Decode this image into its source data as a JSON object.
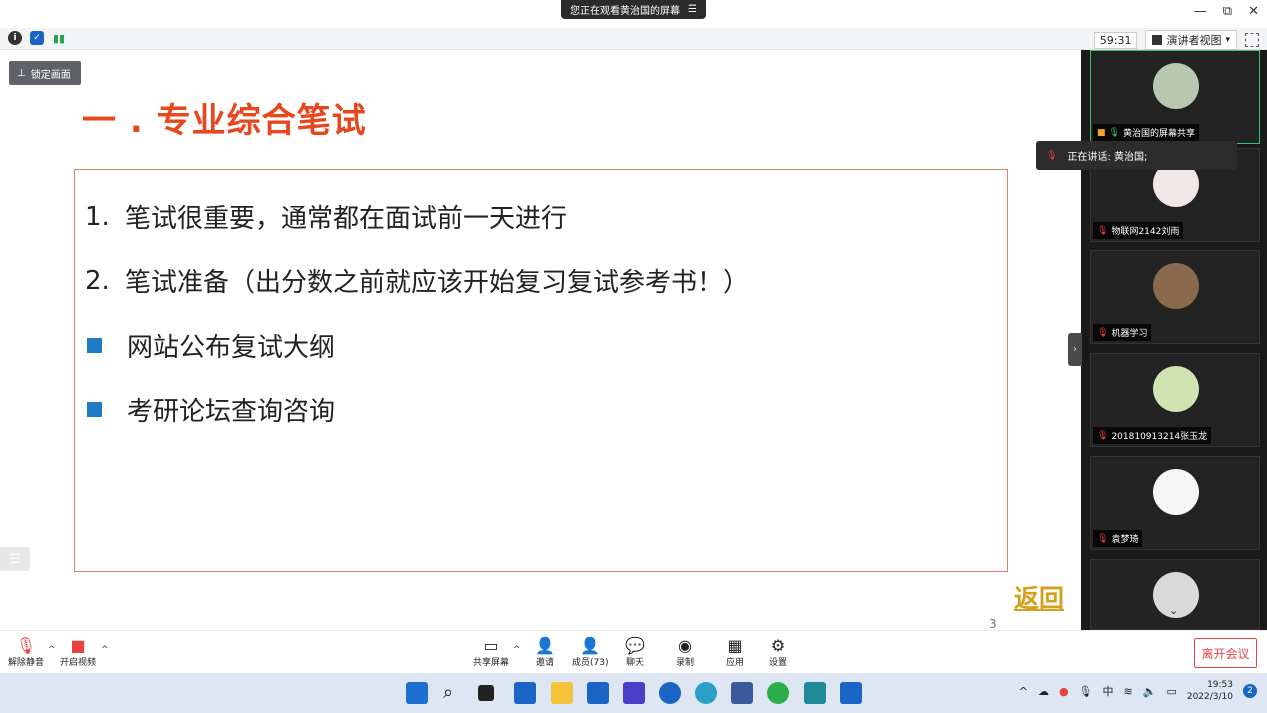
{
  "banner": {
    "text": "您正在观看黄治国的屏幕",
    "icon": "menu-icon"
  },
  "window": {
    "minimize": "—",
    "restore": "⧉",
    "close": "✕"
  },
  "toolbar": {
    "timer": "59:31",
    "presenter_view": "演讲者视图",
    "presenter_caret": "▾"
  },
  "slide": {
    "lock_label": "锁定画面",
    "title": "一 . 专业综合笔试",
    "lines": [
      {
        "num": "1.",
        "text": "笔试很重要，通常都在面试前一天进行"
      },
      {
        "num": "2.",
        "text": "笔试准备（出分数之前就应该开始复习复试参考书！）"
      },
      {
        "bullet": "square",
        "text": "网站公布复试大纲"
      },
      {
        "bullet": "square",
        "text": "考研论坛查询咨询"
      }
    ],
    "back_label": "返回",
    "page_number": "3"
  },
  "speaking_tooltip": {
    "text": "正在讲话: 黄治国;"
  },
  "participants": [
    {
      "label": "黄治国的屏幕共享",
      "avatar_color": "#b9c8b0"
    },
    {
      "label": "物联网2142刘雨",
      "avatar_color": "#f3e6e6"
    },
    {
      "label": "机器学习",
      "avatar_color": "#8a6a4e"
    },
    {
      "label": "201810913214张玉龙",
      "avatar_color": "#cfe4b0"
    },
    {
      "label": "袁梦琦",
      "avatar_color": "#f7f7f7"
    },
    {
      "label": "",
      "avatar_color": "#d9d9d9"
    }
  ],
  "controls": {
    "unmute": "解除静音",
    "start_video": "开启视频",
    "share_screen": "共享屏幕",
    "invite": "邀请",
    "members": "成员(73)",
    "chat": "聊天",
    "record": "录制",
    "apps": "应用",
    "settings": "设置",
    "leave": "离开会议"
  },
  "taskbar": {
    "tray_ime": "中",
    "time": "19:53",
    "date": "2022/3/10",
    "notifications": "2"
  },
  "colors": {
    "accent_red": "#e8461c",
    "bullet_blue": "#1f7ac7",
    "back_gold": "#d4a017",
    "leave_red": "#e84545"
  }
}
